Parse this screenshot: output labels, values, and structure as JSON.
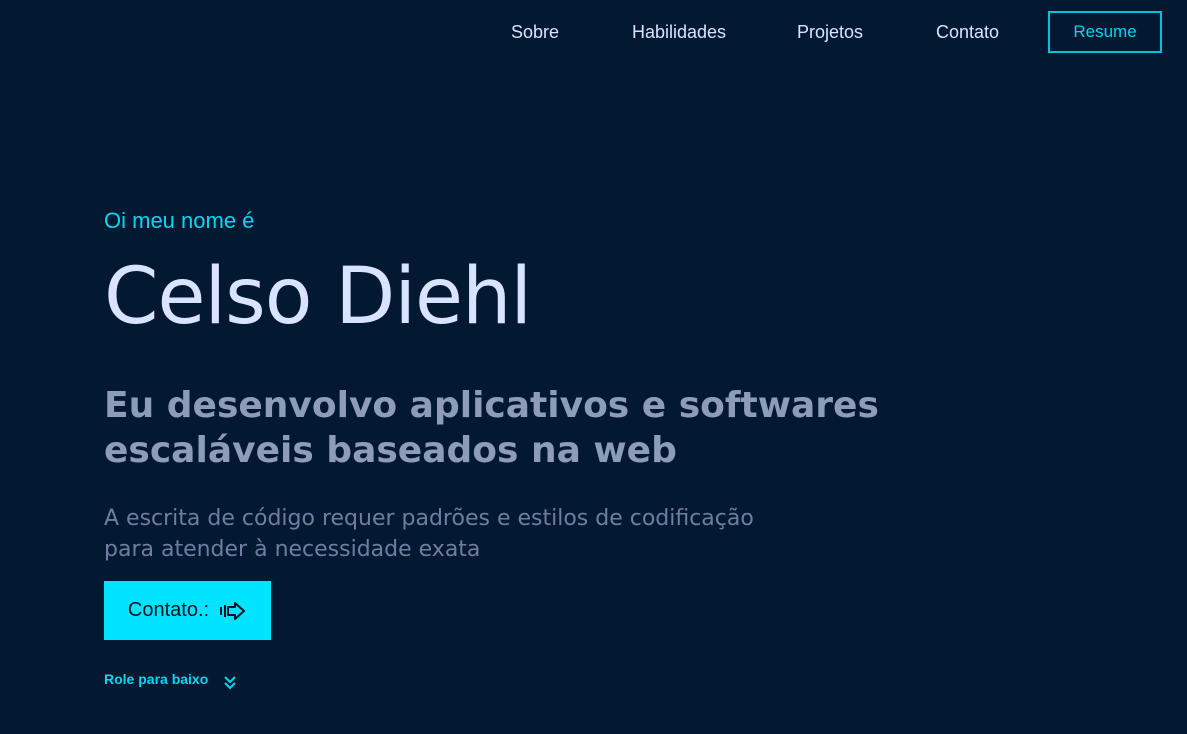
{
  "nav": {
    "items": [
      {
        "label": "Sobre"
      },
      {
        "label": "Habilidades"
      },
      {
        "label": "Projetos"
      },
      {
        "label": "Contato"
      }
    ],
    "resume_label": "Resume"
  },
  "hero": {
    "greeting": "Oi meu nome é",
    "name": "Celso Diehl",
    "subtitle": "Eu desenvolvo aplicativos e softwares escaláveis baseados na web",
    "description": "A escrita de código requer padrões e estilos de codificação para atender à necessidade exata",
    "contact_button_label": "Contato.:",
    "contact_icon": "arrow-right-icon",
    "scroll_label": "Role para baixo",
    "scroll_icon": "double-chevron-down-icon"
  },
  "colors": {
    "background": "#031931",
    "accent": "#00e4ff",
    "name": "#d8e4ff",
    "subtitle": "#8d9cb8",
    "description": "#6d7ea1"
  }
}
